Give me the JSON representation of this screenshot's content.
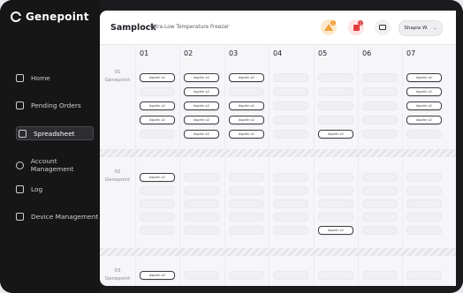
{
  "brand": {
    "name": "Genepoint"
  },
  "nav": {
    "items": [
      {
        "label": "Home",
        "icon": "home-icon"
      },
      {
        "label": "Pending Orders",
        "icon": "pending-orders-icon"
      },
      {
        "label": "Spreadsheet",
        "icon": "spreadsheet-icon",
        "active": true
      },
      {
        "label": "Account Management",
        "icon": "account-icon"
      },
      {
        "label": "Log",
        "icon": "log-icon"
      },
      {
        "label": "Device Management",
        "icon": "device-icon"
      }
    ]
  },
  "header": {
    "title": "Samplock",
    "subtitle": "Ultra-Low Temperature Freezer",
    "warning_badge": "1",
    "alert_badge": "1",
    "user_name": "Shapia W.",
    "user_menu_icon": "chevron-down-icon"
  },
  "grid": {
    "columns": [
      "01",
      "02",
      "03",
      "04",
      "05",
      "06",
      "07"
    ],
    "sections": [
      {
        "row_label": [
          "01",
          "Genepoint"
        ]
      },
      {
        "row_label": [
          "02",
          "Genepoint"
        ]
      },
      {
        "row_label": [
          "03",
          "Genepoint"
        ]
      }
    ],
    "sample_label": "Aspirin x2"
  },
  "colors": {
    "sidebar": "#161617",
    "accent": "#f0a23c",
    "alert": "#e23d3d"
  }
}
